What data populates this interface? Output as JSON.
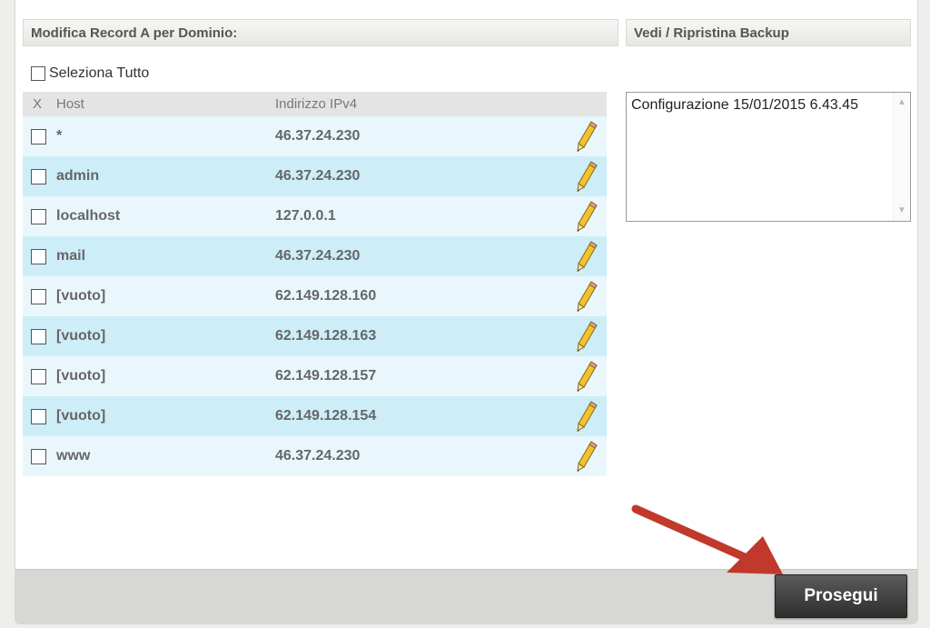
{
  "edit_section": {
    "title": "Modifica Record A per Dominio:",
    "select_all_label": "Seleziona Tutto",
    "columns": {
      "x": "X",
      "host": "Host",
      "ip": "Indirizzo IPv4"
    },
    "rows": [
      {
        "host": "*",
        "ip": "46.37.24.230"
      },
      {
        "host": "admin",
        "ip": "46.37.24.230"
      },
      {
        "host": "localhost",
        "ip": "127.0.0.1"
      },
      {
        "host": "mail",
        "ip": "46.37.24.230"
      },
      {
        "host": "[vuoto]",
        "ip": "62.149.128.160"
      },
      {
        "host": "[vuoto]",
        "ip": "62.149.128.163"
      },
      {
        "host": "[vuoto]",
        "ip": "62.149.128.157"
      },
      {
        "host": "[vuoto]",
        "ip": "62.149.128.154"
      },
      {
        "host": "www",
        "ip": "46.37.24.230"
      }
    ],
    "edit_icon": "pencil-icon"
  },
  "backup_section": {
    "title": "Vedi / Ripristina Backup",
    "items": [
      "Configurazione 15/01/2015 6.43.45"
    ]
  },
  "footer": {
    "continue_label": "Prosegui"
  },
  "colors": {
    "row_light": "#e9f7fd",
    "row_dark": "#cdedf9",
    "button_bg": "#3c3c3c",
    "arrow": "#c0392b"
  }
}
